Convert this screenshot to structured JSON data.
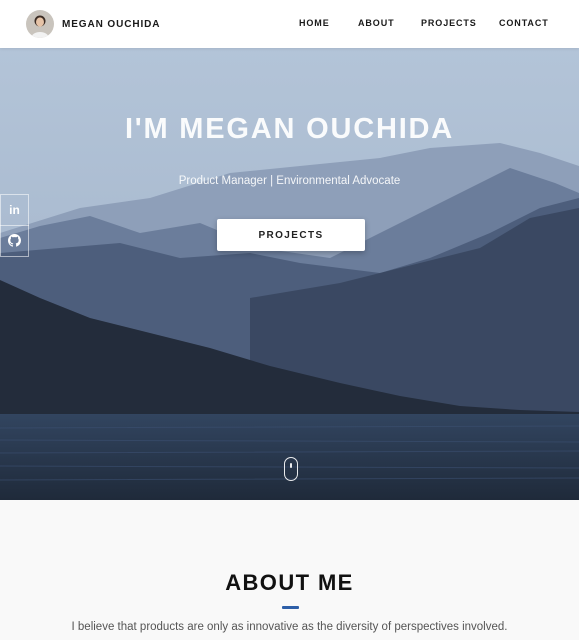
{
  "header": {
    "brand_name": "MEGAN OUCHIDA",
    "nav": [
      "HOME",
      "ABOUT",
      "PROJECTS",
      "CONTACT"
    ]
  },
  "hero": {
    "title": "I'M MEGAN OUCHIDA",
    "subtitle": "Product Manager | Environmental Advocate",
    "cta_label": "PROJECTS"
  },
  "social": {
    "items": [
      {
        "icon": "linkedin-icon",
        "text": "in"
      },
      {
        "icon": "github-icon"
      }
    ]
  },
  "about": {
    "title": "ABOUT ME",
    "text": "I believe that products are only as innovative as the diversity of perspectives involved."
  },
  "colors": {
    "accent": "#2e5fa8",
    "header_bg": "#ffffff",
    "sky": "#a9bcd2",
    "water": "#2a3a52"
  }
}
